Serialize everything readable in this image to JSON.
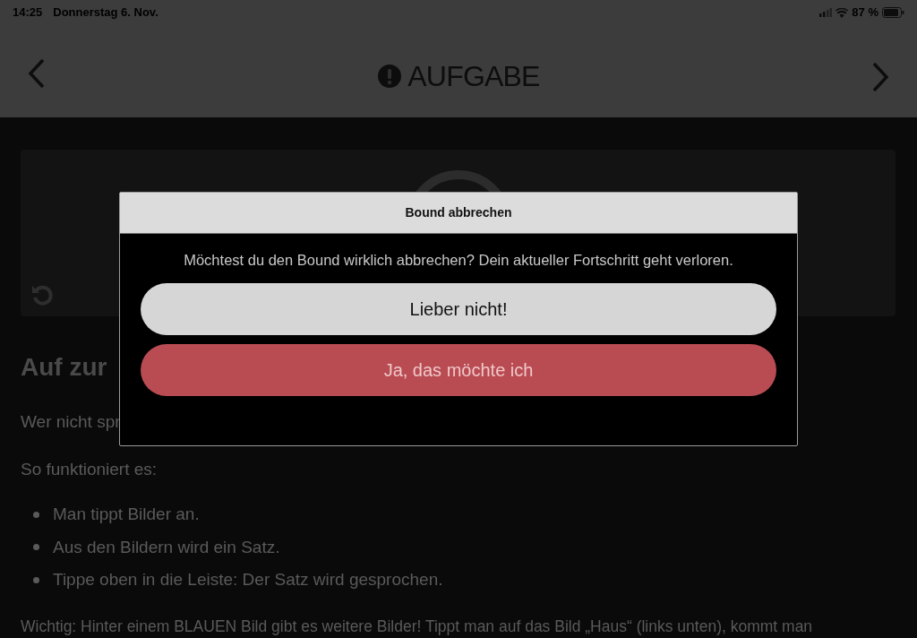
{
  "status_bar": {
    "time": "14:25",
    "date": "Donnerstag 6. Nov.",
    "battery": "87 %"
  },
  "header": {
    "title": "AUFGABE"
  },
  "content": {
    "heading": "Auf zur",
    "paragraphs": [
      "Wer nicht spr",
      "So funktioniert es:"
    ],
    "bullets": [
      "Man tippt Bilder an.",
      "Aus den Bildern wird ein Satz.",
      "Tippe oben in die Leiste: Der Satz wird gesprochen."
    ],
    "note": "Wichtig: Hinter einem BLAUEN Bild gibt es weitere Bilder! Tippt man auf das Bild „Haus“ (links unten), kommt man"
  },
  "dialog": {
    "title": "Bound abbrechen",
    "message": "Möchtest du den Bound wirklich abbrechen? Dein aktueller Fortschritt geht verloren.",
    "buttons": [
      {
        "label": "Lieber nicht!",
        "kind": "secondary"
      },
      {
        "label": "Ja, das möchte ich",
        "kind": "destructive"
      }
    ]
  }
}
